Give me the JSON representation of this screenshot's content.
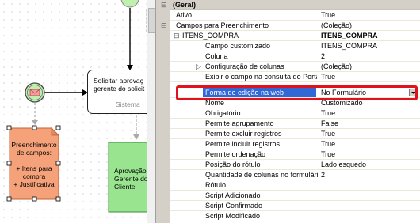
{
  "diagram": {
    "process_label": "Solicitar aprovação do\ngerente do solicitante",
    "process_lines": [
      "Solicitar aprovaç",
      "gerente do solicit"
    ],
    "lane": "Sistema",
    "note_lines": [
      "Preenchimento",
      "de campos:",
      "",
      "+ Itens para",
      "compra",
      "+ Justificativa"
    ],
    "green_lines": [
      "Aprovação",
      "Gerente do",
      "Cliente"
    ]
  },
  "properties": {
    "rows": [
      {
        "name": "(Geral)",
        "value": "",
        "type": "category"
      },
      {
        "name": "Ativo",
        "value": "True"
      },
      {
        "name": "Campos para Preenchimento",
        "value": "(Coleção)"
      },
      {
        "name": "ITENS_COMPRA",
        "value": "ITENS_COMPRA",
        "bold": true
      },
      {
        "name": "Campo customizado",
        "value": "ITENS_COMPRA"
      },
      {
        "name": "Coluna",
        "value": "2"
      },
      {
        "name": "Configuração de colunas",
        "value": "(Coleção)"
      },
      {
        "name": "Exibir o campo na consulta do Portal",
        "value": "True"
      },
      {
        "name": "Forma de edição na web",
        "value": "No Formulário",
        "selected": true
      },
      {
        "name": "Nome",
        "value": "Customizado"
      },
      {
        "name": "Obrigatório",
        "value": "True"
      },
      {
        "name": "Permite agrupamento",
        "value": "False"
      },
      {
        "name": "Permite excluir registros",
        "value": "True"
      },
      {
        "name": "Permite incluir registros",
        "value": "True"
      },
      {
        "name": "Permite ordenação",
        "value": "True"
      },
      {
        "name": "Posição do rótulo",
        "value": "Lado esquedo"
      },
      {
        "name": "Quantidade de colunas no formulário",
        "value": "2"
      },
      {
        "name": "Rótulo",
        "value": ""
      },
      {
        "name": "Script Adicionado",
        "value": ""
      },
      {
        "name": "Script Confirmado",
        "value": ""
      },
      {
        "name": "Script Modificado",
        "value": ""
      }
    ]
  },
  "colors": {
    "highlight": "#e0121b",
    "selection": "#3168d5",
    "note_fill": "#f5a27a",
    "green_fill": "#98e48f",
    "event_green": "#bff0b0"
  },
  "icons": [
    "minus-expander-icon",
    "plus-expander-icon",
    "message-event-icon",
    "dropdown-arrow-icon"
  ]
}
